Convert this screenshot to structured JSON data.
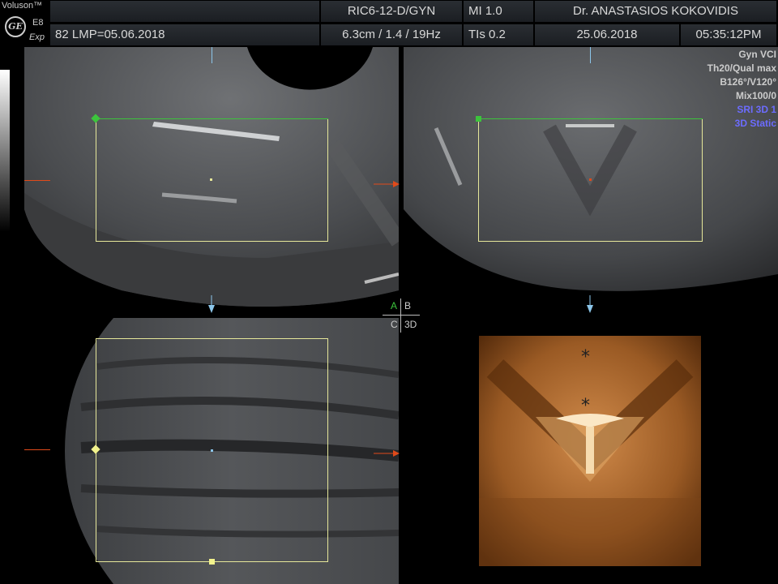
{
  "header": {
    "brand": "Voluson™",
    "model": "E8",
    "mode": "Exp",
    "probe": "RIC6-12-D/GYN",
    "mi": "MI  1.0",
    "doctor": "Dr. ANASTASIOS KOKOVIDIS",
    "patient_info": "82  LMP=05.06.2018",
    "depth_settings": "6.3cm / 1.4 / 19Hz",
    "tis": "TIs  0.2",
    "date": "25.06.2018",
    "time": "05:35:12PM"
  },
  "right_info": {
    "line1": "Gyn VCI",
    "line2": "Th20/Qual max",
    "line3": "B126°/V120°",
    "line4": "Mix100/0",
    "line5": "SRI 3D 1",
    "line6": "3D Static"
  },
  "quad_labels": {
    "a": "A",
    "b": "B",
    "c": "C",
    "d": "3D"
  },
  "render_marks": {
    "star1": "*",
    "star2": "*"
  },
  "colors": {
    "roi": "#e6e79a",
    "orientation_green": "#3cc43c",
    "marker_red": "#e04a1a",
    "sri_blue": "#6c6cff"
  }
}
